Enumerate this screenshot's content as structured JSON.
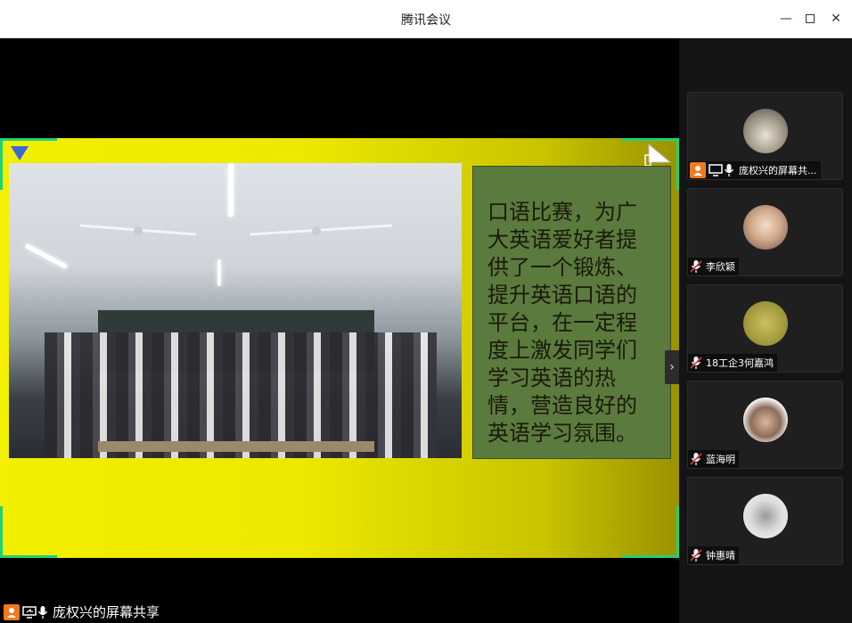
{
  "window": {
    "title": "腾讯会议"
  },
  "slide": {
    "text": "口语比赛，为广大英语爱好者提供了一个锻炼、提升英语口语的平台，在一定程度上激发同学们学习英语的热情，营造良好的英语学习氛围。",
    "accent": "#1fd27a"
  },
  "share": {
    "label": "庞权兴的屏幕共享"
  },
  "participants": [
    {
      "name": "庞权兴的屏幕共...",
      "host": true,
      "sharing": true,
      "muted": false,
      "avatar_color": "#d8d2c6"
    },
    {
      "name": "李欣颖",
      "host": false,
      "sharing": false,
      "muted": true,
      "avatar_color": "#e0b9a0"
    },
    {
      "name": "18工企3何嘉鸿",
      "host": false,
      "sharing": false,
      "muted": true,
      "avatar_color": "#b8a84a"
    },
    {
      "name": "蓝海明",
      "host": false,
      "sharing": false,
      "muted": true,
      "avatar_color": "#e7e7e7"
    },
    {
      "name": "钟惠晴",
      "host": false,
      "sharing": false,
      "muted": true,
      "avatar_color": "#c9c9c9"
    }
  ],
  "colors": {
    "host_badge": "#f07a1a",
    "slide_yellow": "#f3ef00",
    "textbox_green": "#5b7a3e"
  },
  "icons": [
    "minimize-icon",
    "maximize-icon",
    "close-icon",
    "mic-icon",
    "mic-muted-icon",
    "screen-share-icon",
    "host-icon",
    "chevron-right-icon"
  ]
}
